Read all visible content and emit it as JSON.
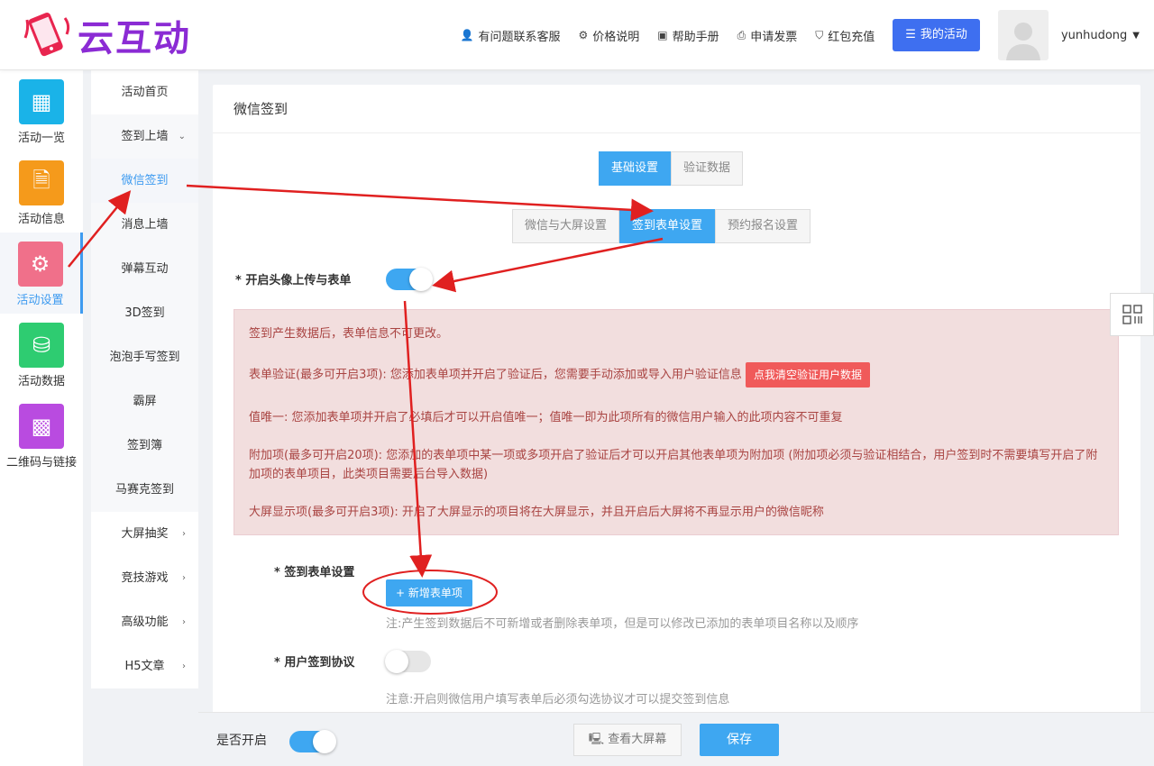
{
  "header": {
    "logo_text": "云互动",
    "nav": [
      {
        "icon": "user-add-icon",
        "label": "有问题联系客服"
      },
      {
        "icon": "gear-icon",
        "label": "价格说明"
      },
      {
        "icon": "book-icon",
        "label": "帮助手册"
      },
      {
        "icon": "printer-icon",
        "label": "申请发票"
      },
      {
        "icon": "shield-icon",
        "label": "红包充值"
      }
    ],
    "my_activity": "我的活动",
    "username": "yunhudong"
  },
  "iconbar": [
    {
      "label": "活动一览",
      "color": "#1ab3e8",
      "icon": "grid-icon"
    },
    {
      "label": "活动信息",
      "color": "#f59a1b",
      "icon": "document-icon"
    },
    {
      "label": "活动设置",
      "color": "#f0708a",
      "icon": "gear-icon",
      "active": true
    },
    {
      "label": "活动数据",
      "color": "#2ecc71",
      "icon": "database-icon"
    },
    {
      "label": "二维码与链接",
      "color": "#b94be0",
      "icon": "qrcode-icon"
    }
  ],
  "submenu": [
    {
      "label": "活动首页"
    },
    {
      "label": "签到上墙",
      "arrow": "⌄"
    },
    {
      "label": "微信签到",
      "active": true
    },
    {
      "label": "消息上墙"
    },
    {
      "label": "弹幕互动"
    },
    {
      "label": "3D签到"
    },
    {
      "label": "泡泡手写签到"
    },
    {
      "label": "霸屏"
    },
    {
      "label": "签到簿"
    },
    {
      "label": "马赛克签到"
    },
    {
      "label": "大屏抽奖",
      "arrow": "›"
    },
    {
      "label": "竞技游戏",
      "arrow": "›"
    },
    {
      "label": "高级功能",
      "arrow": "›"
    },
    {
      "label": "H5文章",
      "arrow": "›"
    }
  ],
  "main": {
    "title": "微信签到",
    "tabs1": [
      "基础设置",
      "验证数据"
    ],
    "tabs2": [
      "微信与大屏设置",
      "签到表单设置",
      "预约报名设置"
    ],
    "avatar_upload_label": "* 开启头像上传与表单",
    "alert": {
      "line1": "签到产生数据后，表单信息不可更改。",
      "line2": "表单验证(最多可开启3项): 您添加表单项并开启了验证后，您需要手动添加或导入用户验证信息",
      "clear_button": "点我清空验证用户数据",
      "line3": "值唯一: 您添加表单项并开启了必填后才可以开启值唯一；值唯一即为此项所有的微信用户输入的此项内容不可重复",
      "line4": "附加项(最多可开启20项): 您添加的表单项中某一项或多项开启了验证后才可以开启其他表单项为附加项 (附加项必须与验证相结合，用户签到时不需要填写开启了附加项的表单项目，此类项目需要后台导入数据)",
      "line5": "大屏显示项(最多可开启3项): 开启了大屏显示的项目将在大屏显示，并且开启后大屏将不再显示用户的微信昵称"
    },
    "form_setting_label": "* 签到表单设置",
    "add_item_button": "+ 新增表单项",
    "form_note": "注:产生签到数据后不可新增或者删除表单项，但是可以修改已添加的表单项目名称以及顺序",
    "agreement_label": "* 用户签到协议",
    "agreement_note": "注意:开启则微信用户填写表单后必须勾选协议才可以提交签到信息"
  },
  "footer": {
    "enable_label": "是否开启",
    "view_screen": "查看大屏幕",
    "save": "保存"
  }
}
